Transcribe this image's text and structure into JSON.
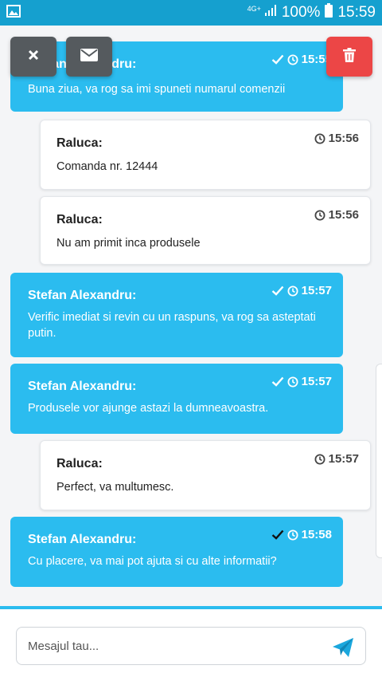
{
  "status_bar": {
    "network": "4G+",
    "battery": "100%",
    "time": "15:59"
  },
  "messages": [
    {
      "direction": "out",
      "sender": "Stefan Alexandru:",
      "time": "15:55",
      "text": "Buna ziua, va rog sa imi spuneti numarul comenzii",
      "read": true
    },
    {
      "direction": "in",
      "sender": "Raluca:",
      "time": "15:56",
      "text": "Comanda nr. 12444"
    },
    {
      "direction": "in",
      "sender": "Raluca:",
      "time": "15:56",
      "text": "Nu am primit inca produsele"
    },
    {
      "direction": "out",
      "sender": "Stefan Alexandru:",
      "time": "15:57",
      "text": "Verific imediat si revin cu un raspuns, va rog sa asteptati putin.",
      "read": true
    },
    {
      "direction": "out",
      "sender": "Stefan Alexandru:",
      "time": "15:57",
      "text": "Produsele vor ajunge astazi la dumneavoastra.",
      "read": true
    },
    {
      "direction": "in",
      "sender": "Raluca:",
      "time": "15:57",
      "text": "Perfect, va multumesc."
    },
    {
      "direction": "out",
      "sender": "Stefan Alexandru:",
      "time": "15:58",
      "text": "Cu placere, va mai pot ajuta si cu alte informatii?",
      "read": false
    }
  ],
  "composer": {
    "placeholder": "Mesajul tau..."
  },
  "icons": {
    "close": "close-icon",
    "mail": "envelope-icon",
    "delete": "trash-icon",
    "send": "send-icon",
    "clock": "clock-icon",
    "check": "check-icon"
  },
  "colors": {
    "status_bar": "#15a0cf",
    "outgoing_bubble": "#2bbcef",
    "incoming_bubble": "#ffffff",
    "delete_button": "#ec4646",
    "action_button": "#555a5e"
  }
}
